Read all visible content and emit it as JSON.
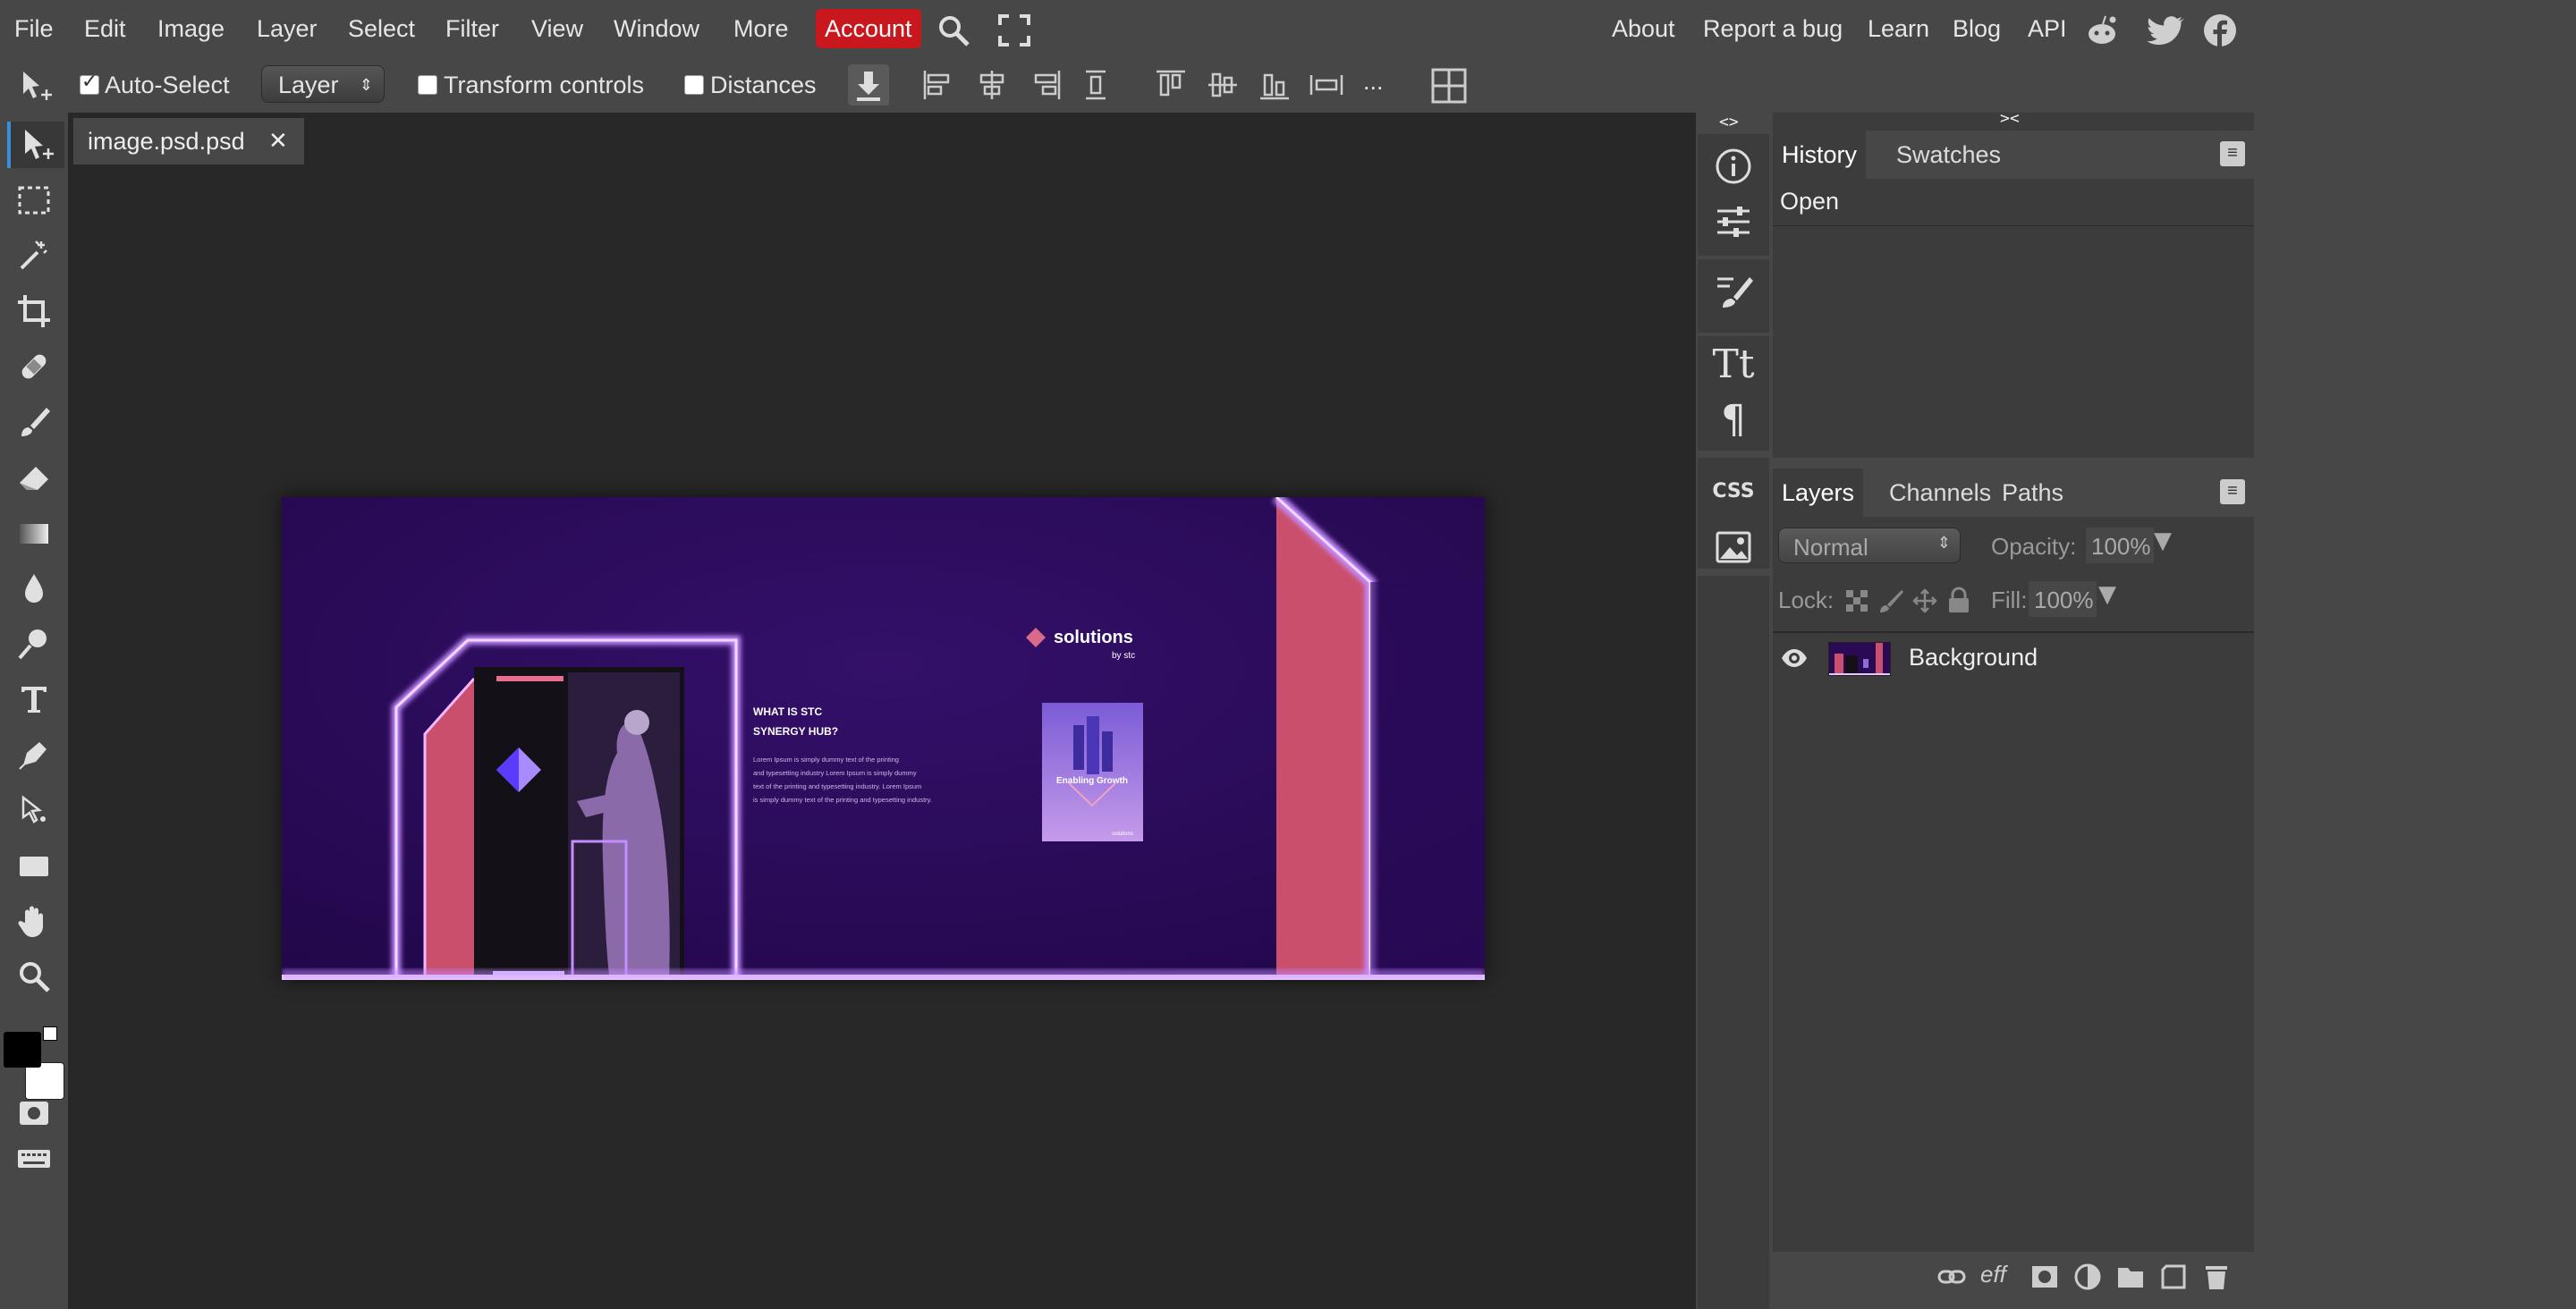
{
  "menu": {
    "file": "File",
    "edit": "Edit",
    "image": "Image",
    "layer": "Layer",
    "select": "Select",
    "filter": "Filter",
    "view": "View",
    "window": "Window",
    "more": "More",
    "account": "Account",
    "about": "About",
    "report_bug": "Report a bug",
    "learn": "Learn",
    "blog": "Blog",
    "api": "API"
  },
  "options": {
    "auto_select_label": "Auto-Select",
    "auto_select_checked": true,
    "layer_select_value": "Layer",
    "transform_controls_label": "Transform controls",
    "transform_controls_checked": false,
    "distances_label": "Distances",
    "distances_checked": false,
    "more_label": "..."
  },
  "document": {
    "tab_name": "image.psd.psd",
    "close_glyph": "✕"
  },
  "canvas": {
    "heading_line1": "WHAT IS STC",
    "heading_line2": "SYNERGY HUB?",
    "body_line1": "Lorem Ipsum is simply dummy text of the printing",
    "body_line2": "and typesetting industry Lorem Ipsum is simply dummy",
    "body_line3": "text of the printing and typesetting industry. Lorem Ipsum",
    "body_line4": "is simply dummy text of the printing and typesetting industry.",
    "logo_text": "solutions",
    "logo_sub": "by stc",
    "poster_text": "Enabling Growth",
    "poster_footer": "solutions"
  },
  "panels": {
    "history_tab": "History",
    "swatches_tab": "Swatches",
    "history_items": [
      "Open"
    ],
    "layers_tab": "Layers",
    "channels_tab": "Channels",
    "paths_tab": "Paths",
    "blend_mode": "Normal",
    "opacity_label": "Opacity:",
    "opacity_value": "100%",
    "lock_label": "Lock:",
    "fill_label": "Fill:",
    "fill_value": "100%",
    "layers": [
      {
        "name": "Background",
        "visible": true
      }
    ],
    "collapse_left": "<>",
    "collapse_right": "><"
  },
  "colors": {
    "account_red": "#c8171d",
    "foreground": "#000000",
    "background": "#ffffff",
    "canvas_purple": "#2a0a54",
    "neon": "#c58cff",
    "pink_panel": "#c94f6d"
  }
}
